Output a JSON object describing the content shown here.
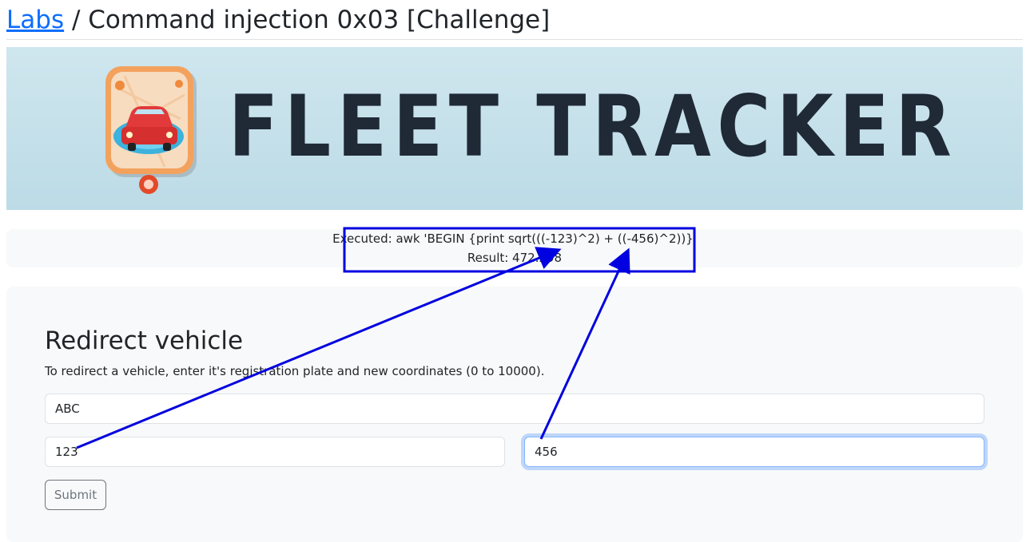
{
  "header": {
    "labs_link": "Labs",
    "title_rest": " / Command injection 0x03 [Challenge]"
  },
  "banner": {
    "text": "FLEET TRACKER",
    "logo_icon": "car-map-pin-icon"
  },
  "result": {
    "executed": "Executed: awk 'BEGIN {print sqrt(((-123)^2) + ((-456)^2))}'",
    "result": "Result: 472.298"
  },
  "form": {
    "heading": "Redirect vehicle",
    "description": "To redirect a vehicle, enter it's registration plate and new coordinates (0 to 10000).",
    "plate_value": "ABC",
    "x_value": "123",
    "y_value": "456",
    "submit_label": "Submit"
  },
  "colors": {
    "link": "#0d6efd",
    "annotation": "#0000e0",
    "banner_text": "#1f2a36"
  }
}
